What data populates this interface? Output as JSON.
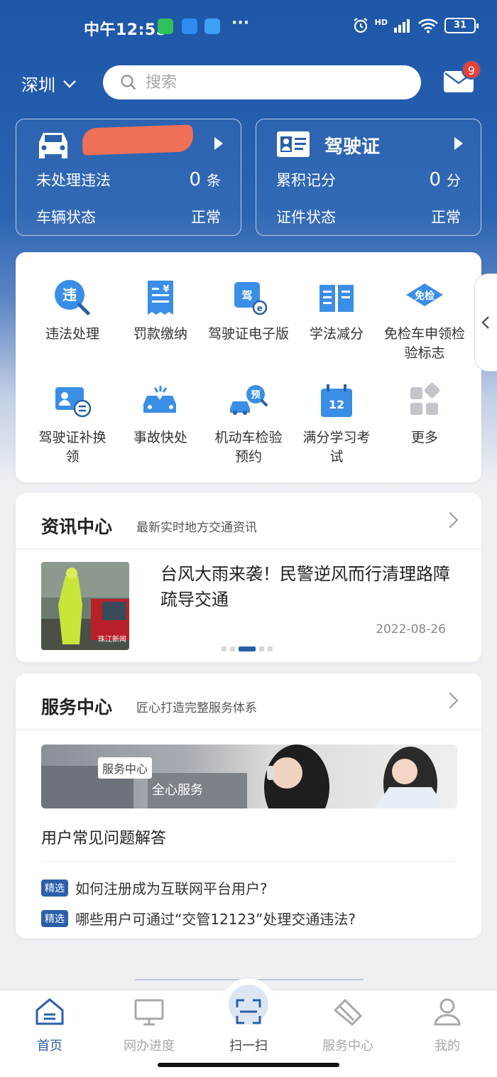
{
  "status_bar": {
    "time": "中午12:55",
    "more": "···",
    "network": "HD",
    "battery": "31"
  },
  "header": {
    "city": "深圳",
    "search_placeholder": "搜索",
    "mail_badge": "9"
  },
  "vehicle_card": {
    "title": "",
    "violation_label": "未处理违法",
    "violation_count": "0",
    "violation_unit": "条",
    "status_label": "车辆状态",
    "status_value": "正常"
  },
  "license_card": {
    "title": "驾驶证",
    "points_label": "累积记分",
    "points_value": "0",
    "points_unit": "分",
    "status_label": "证件状态",
    "status_value": "正常"
  },
  "services": [
    {
      "label": "违法处理",
      "icon": "violation-search-icon"
    },
    {
      "label": "罚款缴纳",
      "icon": "fine-receipt-icon"
    },
    {
      "label": "驾驶证电子版",
      "icon": "e-license-icon"
    },
    {
      "label": "学法减分",
      "icon": "book-icon"
    },
    {
      "label": "免检车申领检验标志",
      "icon": "inspection-exempt-icon"
    },
    {
      "label": "驾驶证补换领",
      "icon": "license-renew-icon"
    },
    {
      "label": "事故快处",
      "icon": "accident-icon"
    },
    {
      "label": "机动车检验预约",
      "icon": "inspection-booking-icon"
    },
    {
      "label": "满分学习考试",
      "icon": "exam-calendar-icon"
    },
    {
      "label": "更多",
      "icon": "more-grid-icon"
    }
  ],
  "service_badges": {
    "violation": "违",
    "license_e": "驾",
    "exempt": "免检",
    "booking": "预",
    "exam": "12"
  },
  "news": {
    "title": "资讯中心",
    "subtitle": "最新实时地方交通资讯",
    "headline": "台风大雨来袭！民警逆风而行清理路障疏导交通",
    "date": "2022-08-26",
    "image_watermark": "珠江新闻"
  },
  "service_center": {
    "title": "服务中心",
    "subtitle": "匠心打造完整服务体系",
    "banner_tag": "服务中心",
    "banner_text": "全心服务",
    "faq_title": "用户常见问题解答",
    "faq_tag": "精选",
    "faqs": [
      "如何注册成为互联网平台用户?",
      "哪些用户可通过“交管12123”处理交通违法?"
    ]
  },
  "tabbar": [
    {
      "label": "首页",
      "icon": "home-icon",
      "active": true
    },
    {
      "label": "网办进度",
      "icon": "monitor-icon",
      "active": false
    },
    {
      "label": "扫一扫",
      "icon": "scan-icon",
      "active": false
    },
    {
      "label": "服务中心",
      "icon": "handshake-icon",
      "active": false
    },
    {
      "label": "我的",
      "icon": "user-icon",
      "active": false
    }
  ],
  "colors": {
    "brand_blue": "#2a5fa9",
    "header_blue": "#1e56a8",
    "badge_red": "#e8403a",
    "redaction": "#ef6f57"
  }
}
